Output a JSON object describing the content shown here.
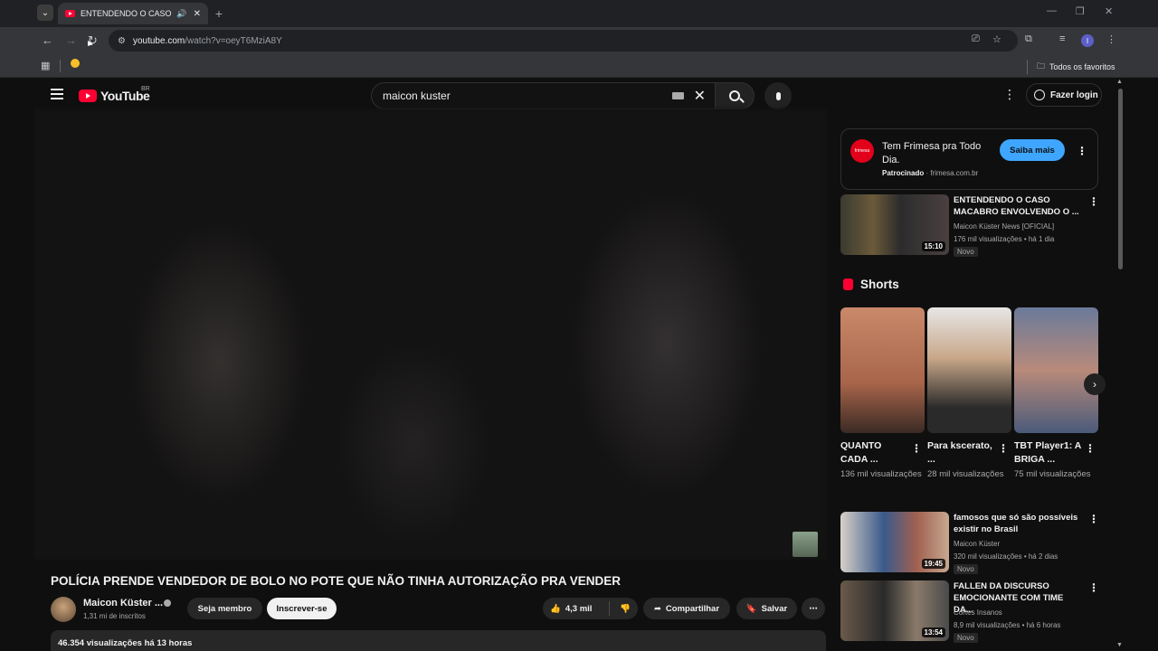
{
  "browser": {
    "tab_title": "ENTENDENDO O CASO MA",
    "url_host": "youtube.com",
    "url_path": "/watch?v=oeyT6MziA8Y",
    "bookmarks_all": "Todos os favoritos",
    "profile_initial": "I"
  },
  "youtube": {
    "logo_text": "YouTube",
    "country_code": "BR",
    "search_query": "maicon kuster",
    "login_label": "Fazer login"
  },
  "video": {
    "title": "POLÍCIA PRENDE VENDEDOR DE BOLO NO POTE QUE NÃO TINHA AUTORIZAÇÃO PRA VENDER",
    "channel": "Maicon Küster ...",
    "subscribers": "1,31 mi de inscritos",
    "member_label": "Seja membro",
    "subscribe_label": "Inscrever-se",
    "likes": "4,3 mil",
    "share_label": "Compartilhar",
    "save_label": "Salvar",
    "views_line": "46.354 visualizações  há 13 horas"
  },
  "ad": {
    "title": "Tem Frimesa pra Todo Dia.",
    "sponsored": "Patrocinado",
    "domain": "· frimesa.com.br",
    "cta": "Saiba mais",
    "logo_text": "frimesa"
  },
  "sidebar_videos": [
    {
      "title": "ENTENDENDO O CASO MACABRO ENVOLVENDO O ...",
      "channel": "Maicon Küster News [OFICIAL]",
      "meta": "176 mil visualizações • há 1 dia",
      "badge": "Novo",
      "duration": "15:10"
    },
    {
      "title": "famosos que só são possíveis existir no Brasil",
      "channel": "Maicon Küster",
      "meta": "320 mil visualizações • há 2 dias",
      "badge": "Novo",
      "duration": "19:45"
    },
    {
      "title": "FALLEN DA DISCURSO EMOCIONANTE COM TIME DA...",
      "channel": "Cortes Insanos",
      "meta": "8,9 mil visualizações • há 6 horas",
      "badge": "Novo",
      "duration": "13:54"
    }
  ],
  "shorts": {
    "heading": "Shorts",
    "items": [
      {
        "title": "QUANTO CADA ...",
        "views": "136 mil visualizações"
      },
      {
        "title": "Para kscerato, ...",
        "views": "28 mil visualizações"
      },
      {
        "title": "TBT Player1: A BRIGA ...",
        "views": "75 mil visualizações"
      }
    ]
  }
}
